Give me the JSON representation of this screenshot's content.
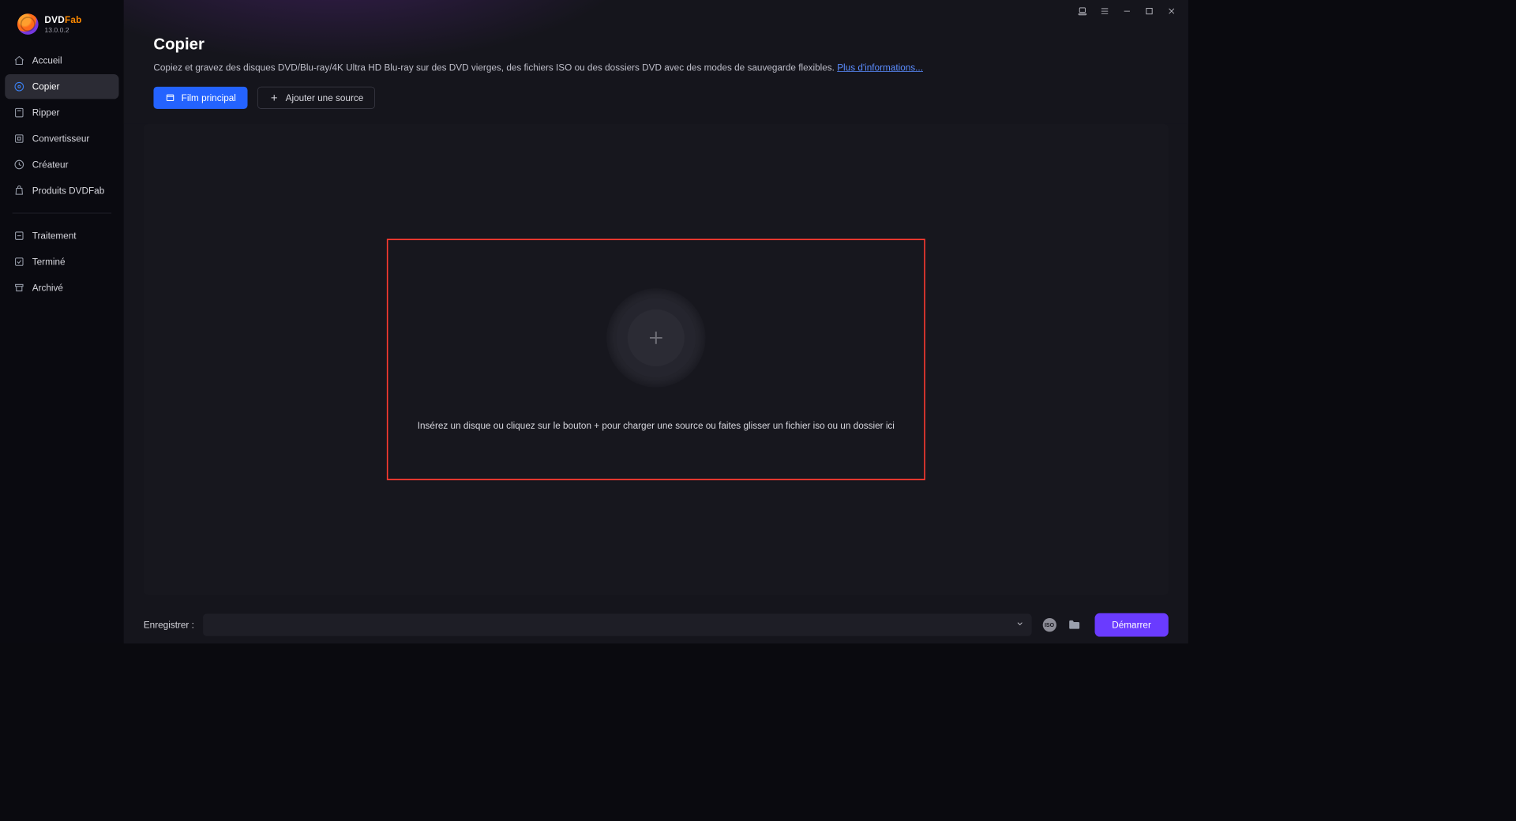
{
  "app": {
    "brand_a": "DVD",
    "brand_b": "Fab",
    "version": "13.0.0.2"
  },
  "window_controls": {
    "app_icon": "app-switcher",
    "menu_icon": "hamburger",
    "minimize": "minimize",
    "maximize": "maximize",
    "close": "close"
  },
  "sidebar": {
    "items": [
      {
        "id": "home",
        "label": "Accueil",
        "icon": "home-icon",
        "active": false
      },
      {
        "id": "copy",
        "label": "Copier",
        "icon": "disc-icon",
        "active": true
      },
      {
        "id": "ripper",
        "label": "Ripper",
        "icon": "rip-icon",
        "active": false
      },
      {
        "id": "converter",
        "label": "Convertisseur",
        "icon": "convert-icon",
        "active": false
      },
      {
        "id": "creator",
        "label": "Créateur",
        "icon": "create-icon",
        "active": false
      },
      {
        "id": "products",
        "label": "Produits DVDFab",
        "icon": "bag-icon",
        "active": false
      }
    ],
    "secondary": [
      {
        "id": "process",
        "label": "Traitement",
        "icon": "clock-icon"
      },
      {
        "id": "done",
        "label": "Terminé",
        "icon": "check-icon"
      },
      {
        "id": "archived",
        "label": "Archivé",
        "icon": "archive-icon"
      }
    ]
  },
  "page": {
    "title": "Copier",
    "description": "Copiez et gravez des disques DVD/Blu-ray/4K Ultra HD Blu-ray sur des DVD vierges, des fichiers ISO ou des dossiers DVD avec des modes de sauvegarde flexibles. ",
    "more_link": "Plus d'informations...",
    "toolbar": {
      "main_movie": "Film principal",
      "add_source": "Ajouter une source"
    },
    "dropzone_text": "Insérez un disque ou cliquez sur le bouton +  pour charger une source ou faites glisser un fichier iso ou un dossier ici"
  },
  "footer": {
    "save_label": "Enregistrer :",
    "save_path": "",
    "iso_label": "ISO",
    "start": "Démarrer"
  }
}
